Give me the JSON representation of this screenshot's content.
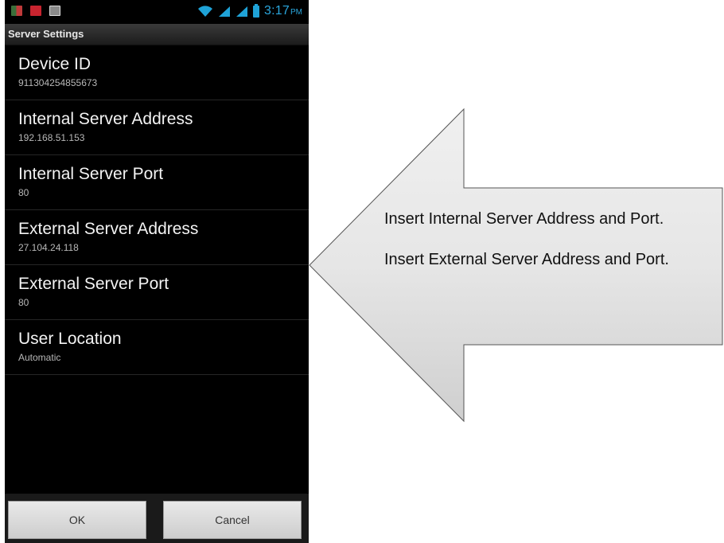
{
  "status_bar": {
    "time": "3:17",
    "ampm": "PM",
    "icons": [
      "notification-icon",
      "app-icon",
      "image-icon",
      "wifi-icon",
      "signal-icon",
      "signal-icon",
      "battery-icon"
    ]
  },
  "screen": {
    "title": "Server Settings",
    "settings": [
      {
        "label": "Device ID",
        "value": "911304254855673"
      },
      {
        "label": "Internal Server Address",
        "value": "192.168.51.153"
      },
      {
        "label": "Internal Server Port",
        "value": "80"
      },
      {
        "label": "External Server Address",
        "value": "27.104.24.118"
      },
      {
        "label": "External Server Port",
        "value": "80"
      },
      {
        "label": "User Location",
        "value": "Automatic"
      }
    ],
    "buttons": {
      "ok": "OK",
      "cancel": "Cancel"
    }
  },
  "callout": {
    "line1": "Insert Internal Server Address and Port.",
    "line2": "Insert External Server Address and Port."
  },
  "colors": {
    "status_accent": "#2aa7de",
    "callout_fill": "#e2e2e2"
  }
}
